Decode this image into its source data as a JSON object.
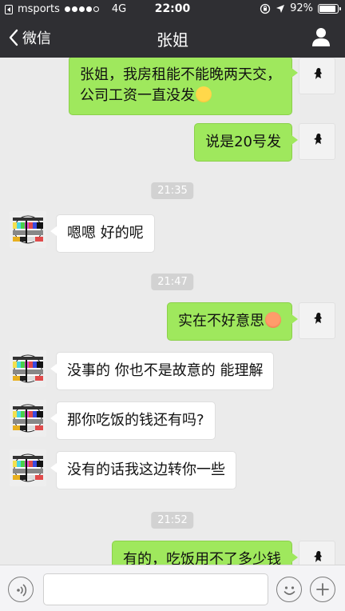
{
  "status_bar": {
    "carrier": "msports",
    "network": "4G",
    "time": "22:00",
    "battery": "92%",
    "battery_level": 0.92
  },
  "nav": {
    "back_label": "微信",
    "title": "张姐"
  },
  "messages": [
    {
      "side": "me",
      "text": "张姐，我房租能不能晚两天交，",
      "text2": "公司工资一直没发"
    },
    {
      "side": "me",
      "text": "说是20号发"
    },
    {
      "type": "time",
      "text": "21:35"
    },
    {
      "side": "other",
      "text": "嗯嗯 好的呢"
    },
    {
      "type": "time",
      "text": "21:47"
    },
    {
      "side": "me",
      "text": "实在不好意思"
    },
    {
      "side": "other",
      "text": "没事的 你也不是故意的 能理解"
    },
    {
      "side": "other",
      "text": "那你吃饭的钱还有吗?"
    },
    {
      "side": "other",
      "text": "没有的话我这边转你一些"
    },
    {
      "type": "time",
      "text": "21:52"
    },
    {
      "side": "me",
      "text": "有的，吃饭用不了多少钱"
    }
  ],
  "icons": {
    "back": "chevron-left-icon",
    "profile": "person-icon",
    "voice": "voice-icon",
    "emoji": "smiley-icon",
    "plus": "plus-icon"
  },
  "colors": {
    "topbar": "#2f2f33",
    "chat_bg": "#ebebeb",
    "my_bubble": "#9fe85d",
    "other_bubble": "#ffffff"
  }
}
